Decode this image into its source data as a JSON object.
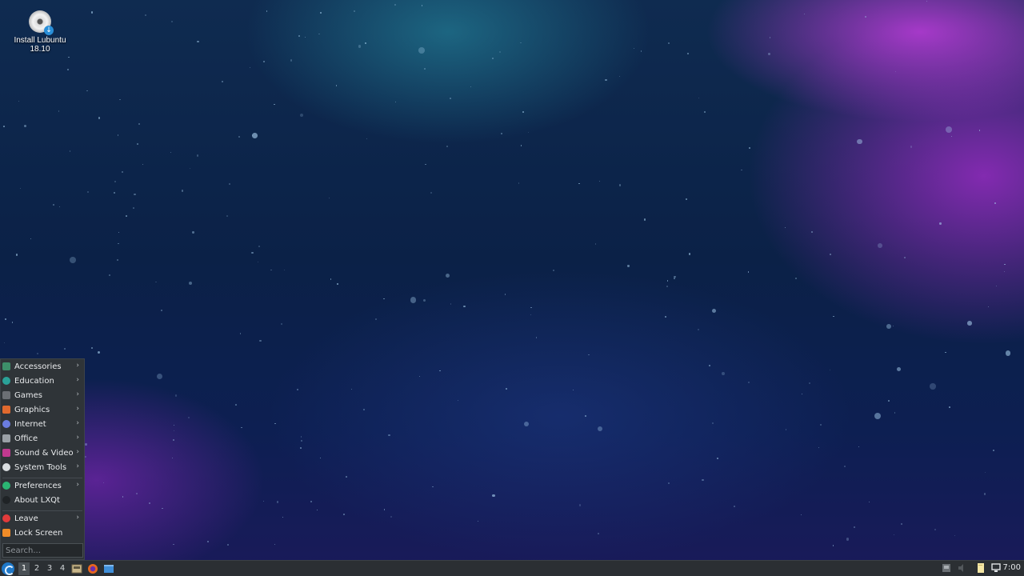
{
  "desktop": {
    "icons": [
      {
        "label_line1": "Install Lubuntu",
        "label_line2": "18.10",
        "icon": "install-disc-icon"
      }
    ]
  },
  "start_menu": {
    "categories": [
      {
        "label": "Accessories",
        "icon": "accessories-icon",
        "color": "#3d8f6a",
        "submenu": true
      },
      {
        "label": "Education",
        "icon": "education-icon",
        "color": "#2aa198",
        "submenu": true
      },
      {
        "label": "Games",
        "icon": "games-icon",
        "color": "#6b6f74",
        "submenu": true
      },
      {
        "label": "Graphics",
        "icon": "graphics-icon",
        "color": "#e0692e",
        "submenu": true
      },
      {
        "label": "Internet",
        "icon": "internet-icon",
        "color": "#6b7de0",
        "submenu": true
      },
      {
        "label": "Office",
        "icon": "office-icon",
        "color": "#9aa0a6",
        "submenu": true
      },
      {
        "label": "Sound & Video",
        "icon": "sound-video-icon",
        "color": "#c0398f",
        "submenu": true
      },
      {
        "label": "System Tools",
        "icon": "system-tools-icon",
        "color": "#d9dde0",
        "submenu": true
      }
    ],
    "settings": [
      {
        "label": "Preferences",
        "icon": "preferences-icon",
        "color": "#2bb673",
        "submenu": true
      },
      {
        "label": "About LXQt",
        "icon": "about-lxqt-icon",
        "color": "#1f2326",
        "submenu": false
      }
    ],
    "session": [
      {
        "label": "Leave",
        "icon": "leave-icon",
        "color": "#e23b3b",
        "submenu": true
      },
      {
        "label": "Lock Screen",
        "icon": "lock-icon",
        "color": "#f08c28",
        "submenu": false
      }
    ],
    "search_placeholder": "Search...",
    "submenu_arrow": "›"
  },
  "taskbar": {
    "workspaces": [
      "1",
      "2",
      "3",
      "4"
    ],
    "active_workspace": "1",
    "clock": "7:00",
    "quicklaunch": [
      "file-manager-icon",
      "firefox-icon",
      "show-desktop-icon"
    ],
    "tray": [
      "keyboard-layout-icon",
      "volume-icon",
      "notes-icon",
      "display-icon"
    ]
  }
}
